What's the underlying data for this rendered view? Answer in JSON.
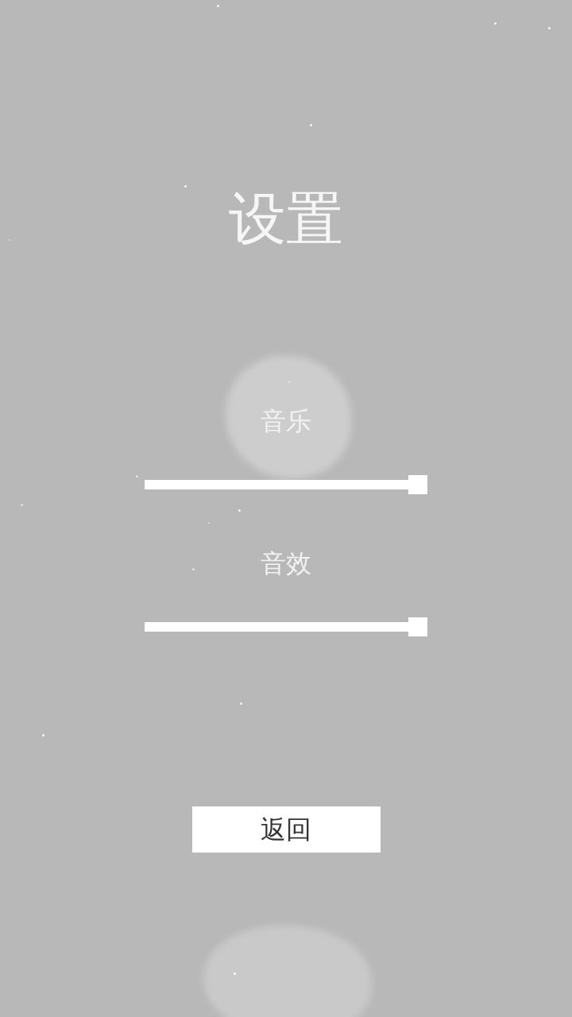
{
  "title": "设置",
  "settings": [
    {
      "label": "音乐",
      "level": 1
    },
    {
      "label": "音效",
      "level": 1
    }
  ],
  "buttons": [
    {
      "label": "返回"
    }
  ]
}
